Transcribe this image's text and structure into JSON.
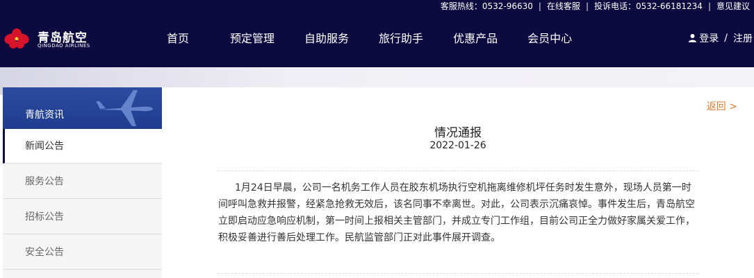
{
  "topbar": {
    "hotline_label": "客服热线：0532-96630",
    "online_service": "在线客服",
    "complaint_label": "投诉电话：0532-66181234",
    "feedback": "意见建议",
    "separator": "|"
  },
  "logo": {
    "name_cn": "青岛航空",
    "name_en": "QINGDAO AIRLINES"
  },
  "nav": {
    "items": [
      {
        "label": "首页"
      },
      {
        "label": "预定管理"
      },
      {
        "label": "自助服务"
      },
      {
        "label": "旅行助手"
      },
      {
        "label": "优惠产品"
      },
      {
        "label": "会员中心"
      }
    ]
  },
  "login": {
    "login_label": "登录",
    "separator": "/",
    "register_label": "注册"
  },
  "sidebar": {
    "title": "青航资讯",
    "items": [
      {
        "label": "新闻公告"
      },
      {
        "label": "服务公告"
      },
      {
        "label": "招标公告"
      },
      {
        "label": "安全公告"
      }
    ]
  },
  "article": {
    "back_label": "返回 >",
    "title": "情况通报",
    "date": "2022-01-26",
    "body": "1月24日早晨，公司一名机务工作人员在胶东机场执行空机拖离维修机坪任务时发生意外，现场人员第一时间呼叫急救并报警，经紧急抢救无效后，该名同事不幸离世。对此，公司表示沉痛哀悼。事件发生后，青岛航空立即启动应急响应机制，第一时间上报相关主管部门，并成立专门工作组，目前公司正全力做好家属关爱工作，积极妥善进行善后处理工作。民航监管部门正对此事件展开调查。"
  },
  "colors": {
    "header_bg": "#0c0a3e",
    "sidebar_head": "#1f3c8e",
    "back_link": "#e07a2a",
    "logo_red": "#d7142a"
  },
  "icons": {
    "logo_mark": "azalea-flower-icon",
    "user": "user-icon",
    "plane": "airplane-icon"
  }
}
